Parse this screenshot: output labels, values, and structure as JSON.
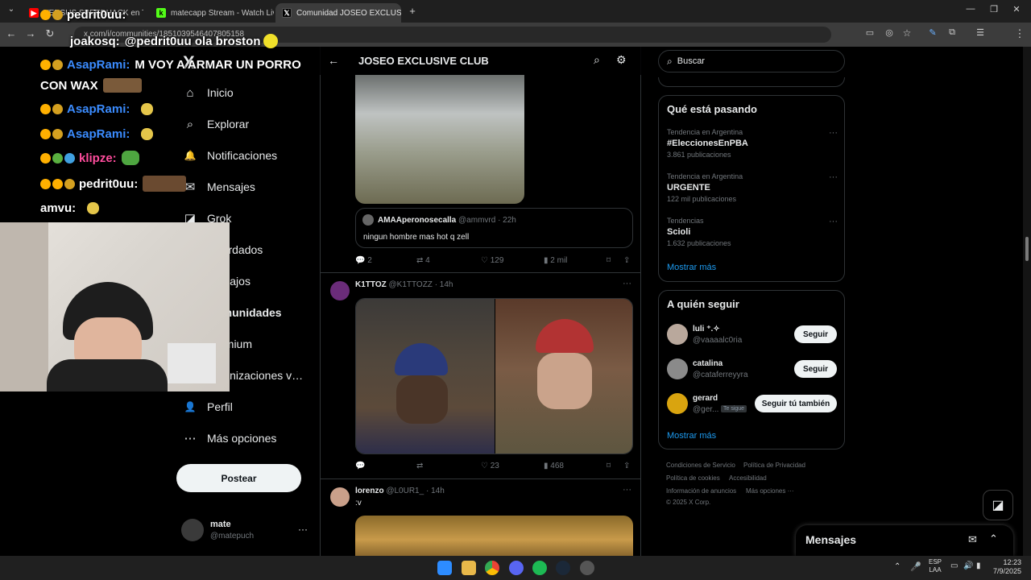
{
  "browser": {
    "tabs": [
      {
        "title": "VERSUS SPEEDHACK en Twi...",
        "active": false
      },
      {
        "title": "matecapp Stream - Watch Live",
        "active": false
      },
      {
        "title": "Comunidad JOSEO EXCLUSIVE",
        "active": true
      }
    ],
    "new_tab": "+",
    "url": "x.com/i/communities/1851039546407805158"
  },
  "x": {
    "logo": "X",
    "nav": [
      {
        "label": "Inicio",
        "icon": "home-icon",
        "glyph": "⌂"
      },
      {
        "label": "Explorar",
        "icon": "search-icon",
        "glyph": "⌕"
      },
      {
        "label": "Notificaciones",
        "icon": "bell-icon",
        "glyph": "🔔"
      },
      {
        "label": "Mensajes",
        "icon": "mail-icon",
        "glyph": "✉"
      },
      {
        "label": "Grok",
        "icon": "grok-icon",
        "glyph": "◪"
      },
      {
        "label": "Guardados",
        "icon": "bookmark-icon",
        "glyph": "🔖"
      },
      {
        "label": "Trabajos",
        "icon": "briefcase-icon",
        "glyph": "💼"
      },
      {
        "label": "Comunidades",
        "icon": "communities-icon",
        "glyph": "👥"
      },
      {
        "label": "Premium",
        "icon": "premium-icon",
        "glyph": "✕"
      },
      {
        "label": "Organizaciones verificadas",
        "icon": "lightning-icon",
        "glyph": "⚡"
      },
      {
        "label": "Perfil",
        "icon": "person-icon",
        "glyph": "👤"
      },
      {
        "label": "Más opciones",
        "icon": "more-circle-icon",
        "glyph": "⋯"
      }
    ],
    "post_button": "Postear",
    "account": {
      "name": "mate",
      "handle": "@matepuch"
    }
  },
  "feed": {
    "title": "JOSEO EXCLUSIVE CLUB",
    "quoted": {
      "name": "AMAAperonosecalla",
      "handle": "@ammvrd",
      "time": "· 22h",
      "text": "ningun hombre mas hot q zell"
    },
    "post1_actions": {
      "replies": "2",
      "reposts": "4",
      "likes": "129",
      "views": "2 mil"
    },
    "post2": {
      "name": "K1TTOZ",
      "handle": "@K1TTOZZ",
      "time": "· 14h",
      "actions": {
        "replies": "",
        "reposts": "",
        "likes": "23",
        "views": "468"
      }
    },
    "post3": {
      "name": "lorenzo",
      "handle": "@L0UR1_",
      "time": "· 14h",
      "text": ":v"
    }
  },
  "sidebar": {
    "search_placeholder": "Buscar",
    "trending_title": "Qué está pasando",
    "trends": [
      {
        "context": "Tendencia en Argentina",
        "name": "#EleccionesEnPBA",
        "count": "3.861 publicaciones"
      },
      {
        "context": "Tendencia en Argentina",
        "name": "URGENTE",
        "count": "122 mil publicaciones"
      },
      {
        "context": "Tendencias",
        "name": "Scioli",
        "count": "1.632 publicaciones"
      }
    ],
    "show_more": "Mostrar más",
    "who_title": "A quién seguir",
    "who": [
      {
        "name": "luli ⁺.✧",
        "handle": "@vaaaalc0ria",
        "button": "Seguir",
        "note": ""
      },
      {
        "name": "catalina",
        "handle": "@cataferreyyra",
        "button": "Seguir",
        "note": ""
      },
      {
        "name": "gerard",
        "handle": "@ger...",
        "button": "Seguir tú también",
        "note": "Te sigue"
      }
    ],
    "footer": [
      "Condiciones de Servicio",
      "Política de Privacidad",
      "Política de cookies",
      "Accesibilidad",
      "Información de anuncios",
      "Más opciones ···",
      "© 2025 X Corp."
    ],
    "messages": "Mensajes"
  },
  "stream_chat": [
    {
      "user": "pedrit0uu:",
      "msg": "",
      "color": "#ffffff"
    },
    {
      "user": "joakosq:",
      "msg": "@pedrit0uu ola broston",
      "color": "#ffffff"
    },
    {
      "user": "AsapRami:",
      "msg": "M VOY A ARMAR UN PORRO",
      "color": "#1e90ff"
    },
    {
      "user": "",
      "msg": "CON WAX",
      "color": "#ffffff"
    },
    {
      "user": "AsapRami:",
      "msg": "",
      "color": "#1e90ff"
    },
    {
      "user": "AsapRami:",
      "msg": "",
      "color": "#1e90ff"
    },
    {
      "user": "klipze:",
      "msg": "",
      "color": "#ff4d9d"
    },
    {
      "user": "pedrit0uu:",
      "msg": "",
      "color": "#ffffff"
    },
    {
      "user": "amvu:",
      "msg": "",
      "color": "#ffffff"
    }
  ],
  "taskbar": {
    "lang1": "ESP",
    "lang2": "LAA",
    "time": "12:23",
    "date": "7/9/2025"
  }
}
